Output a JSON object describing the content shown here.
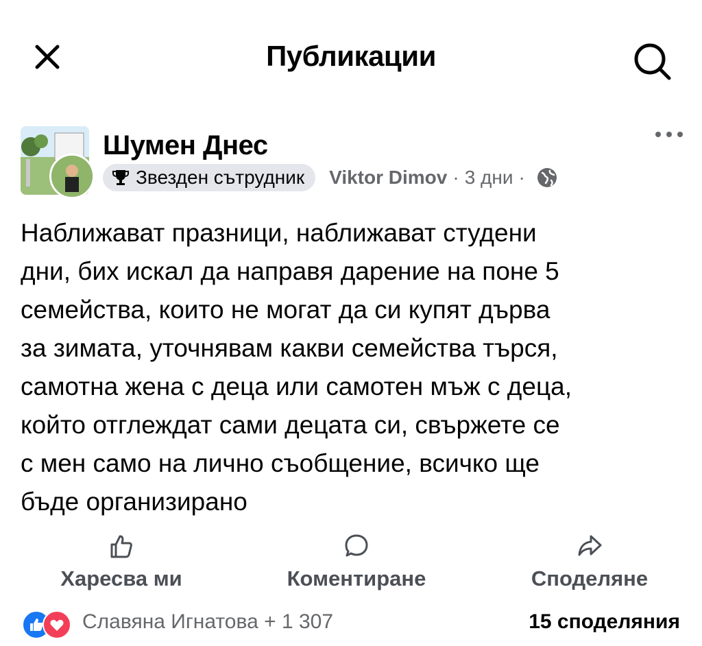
{
  "header": {
    "title": "Публикации",
    "close_icon": "close-icon",
    "search_icon": "search-icon"
  },
  "post": {
    "group_name": "Шумен Днес",
    "badge_label": "Звезден сътрудник",
    "badge_icon": "trophy-icon",
    "author": "Viktor Dimov",
    "time": "3 дни",
    "separator": "·",
    "privacy_icon": "globe-icon",
    "more_icon": "more-options-icon",
    "text": "Наближават празници, наближават студени\nдни, бих искал да направя дарение на поне 5\nсемейства, които не могат да си купят дърва\nза зимата,  уточнявам какви семейства търся,\nсамотна жена с деца или самотен мъж с деца,\nкойто отглеждат сами децата си, свържете се\nс мен само на лично съобщение, всичко ще\nбъде организирано"
  },
  "actions": {
    "like_label": "Харесва ми",
    "comment_label": "Коментиране",
    "share_label": "Споделяне"
  },
  "footer": {
    "reactors": "Славяна Игнатова + 1 307",
    "shares": "15 споделяния"
  },
  "colors": {
    "text": "#050505",
    "secondary": "#65676b",
    "like_blue": "#1877f2",
    "love_red": "#f33e58",
    "badge_bg": "#e4e6eb"
  }
}
